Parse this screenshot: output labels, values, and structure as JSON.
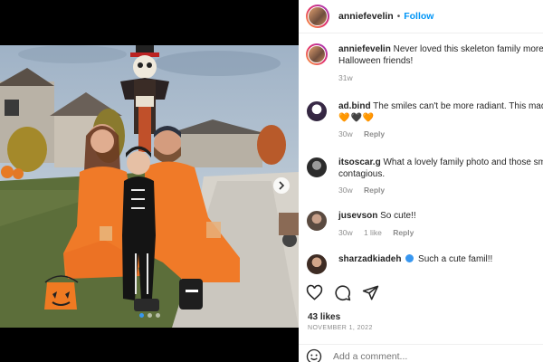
{
  "post": {
    "author": "anniefevelin",
    "follow_label": "Follow",
    "separator": "•"
  },
  "caption": {
    "username": "anniefevelin",
    "text_line1": "Never loved this skeleton family more",
    "text_line2": "Halloween friends!",
    "time": "31w"
  },
  "comments": [
    {
      "username": "ad.bind",
      "text": "The smiles can't be more radiant. This mad",
      "extra": "🧡🖤🧡",
      "time": "30w",
      "reply": "Reply"
    },
    {
      "username": "itsoscar.g",
      "text": "What a lovely family photo and those sm",
      "text2": "contagious.",
      "time": "30w",
      "reply": "Reply"
    },
    {
      "username": "jusevson",
      "text": "So cute!!",
      "time": "30w",
      "likes": "1 like",
      "reply": "Reply"
    },
    {
      "username": "sharzadkiadeh",
      "text": "Such a cute famil!!",
      "verified": true
    }
  ],
  "stats": {
    "likes": "43 likes",
    "date": "NOVEMBER 1, 2022"
  },
  "composer": {
    "placeholder": "Add a comment..."
  },
  "icons": [
    "heart-icon",
    "comment-icon",
    "share-icon",
    "emoji-icon",
    "chevron-right-icon"
  ],
  "colors": {
    "follow": "#0095f6",
    "pajama_orange": "#f07a28"
  }
}
